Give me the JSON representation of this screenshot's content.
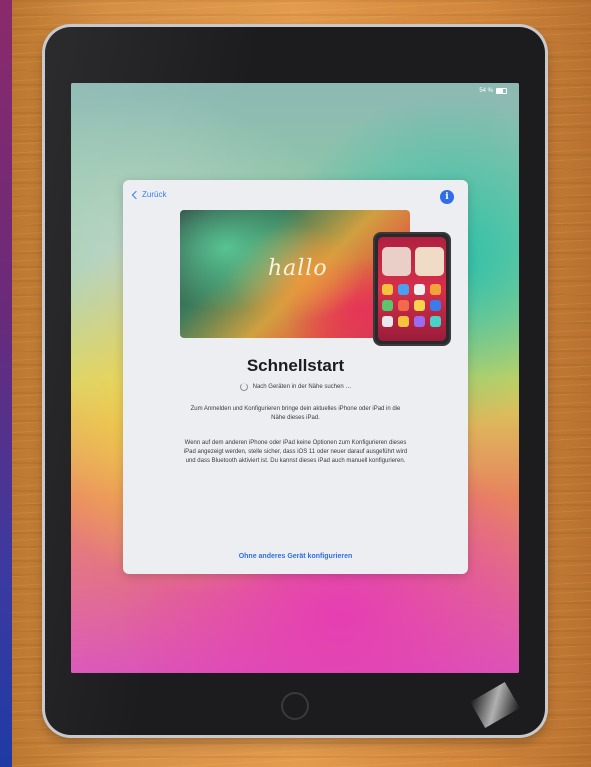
{
  "status_bar": {
    "battery_text": "54 %"
  },
  "sheet": {
    "back_label": "Zurück",
    "info_label": "i",
    "hero_text": "hallo",
    "title": "Schnellstart",
    "searching_text": "Nach Geräten in der Nähe suchen …",
    "paragraph1": "Zum Anmelden und Konfigurieren bringe dein aktuelles iPhone oder iPad in die Nähe dieses iPad.",
    "paragraph2": "Wenn auf dem anderen iPhone oder iPad keine Optionen zum Konfigurieren dieses iPad angezeigt werden, stelle sicher, dass iOS 11 oder neuer darauf ausgeführt wird und dass Bluetooth aktiviert ist. Du kannst dieses iPad auch manuell konfigurieren.",
    "link_label": "Ohne anderes Gerät konfigurieren"
  },
  "colors": {
    "accent": "#2f6ee8",
    "sheet_background": "#eceef2",
    "title_text": "#1c1c1e"
  },
  "icons": [
    "chevron-left-icon",
    "info-icon",
    "spinner-icon",
    "battery-icon"
  ]
}
